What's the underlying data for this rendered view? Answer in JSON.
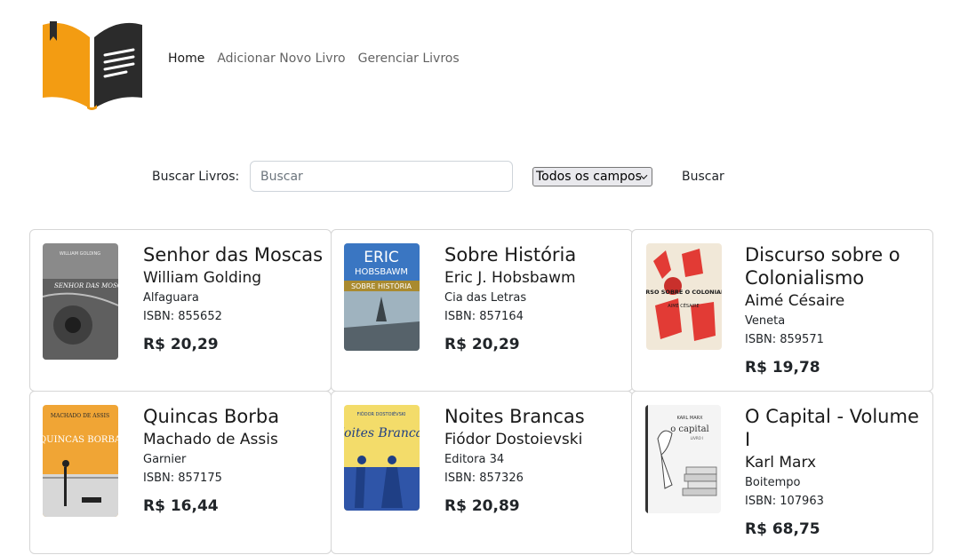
{
  "nav": {
    "home": "Home",
    "add_book": "Adicionar Novo Livro",
    "manage_books": "Gerenciar Livros"
  },
  "search": {
    "label": "Buscar Livros:",
    "placeholder": "Buscar",
    "value": "",
    "field_selected": "Todos os campos",
    "button": "Buscar"
  },
  "books": [
    {
      "title": "Senhor das Moscas",
      "author": "William Golding",
      "publisher": "Alfaguara",
      "isbn": "ISBN: 855652",
      "price": "R$ 20,29"
    },
    {
      "title": "Sobre História",
      "author": "Eric J. Hobsbawm",
      "publisher": "Cia das Letras",
      "isbn": "ISBN: 857164",
      "price": "R$ 20,29"
    },
    {
      "title": "Discurso sobre o Colonialismo",
      "author": "Aimé Césaire",
      "publisher": "Veneta",
      "isbn": "ISBN: 859571",
      "price": "R$ 19,78"
    },
    {
      "title": "Quincas Borba",
      "author": "Machado de Assis",
      "publisher": "Garnier",
      "isbn": "ISBN: 857175",
      "price": "R$ 16,44"
    },
    {
      "title": "Noites Brancas",
      "author": "Fiódor Dostoievski",
      "publisher": "Editora 34",
      "isbn": "ISBN: 857326",
      "price": "R$ 20,89"
    },
    {
      "title": "O Capital - Volume I",
      "author": "Karl Marx",
      "publisher": "Boitempo",
      "isbn": "ISBN: 107963",
      "price": "R$ 68,75"
    }
  ],
  "covers": [
    {
      "top": "WILLIAM GOLDING",
      "main": "SENHOR DAS MOSCAS"
    },
    {
      "top": "ERIC",
      "main": "HOBSBAWM",
      "band": "SOBRE HISTÓRIA"
    },
    {
      "top": "DISCURSO SOBRE O COLONIALISMO",
      "main": "AIMÉ CÉSAIRE"
    },
    {
      "top": "MACHADO DE ASSIS",
      "main": "QUINCAS BORBA"
    },
    {
      "top": "FIÓDOR DOSTOIÉVSKI",
      "main": "Noites Brancas"
    },
    {
      "top": "KARL MARX",
      "main": "o capital",
      "band": "LIVRO I"
    }
  ],
  "colors": {
    "logo_orange": "#f39c12",
    "logo_dark": "#2b2b2b",
    "card_border": "#d6d6d6"
  }
}
